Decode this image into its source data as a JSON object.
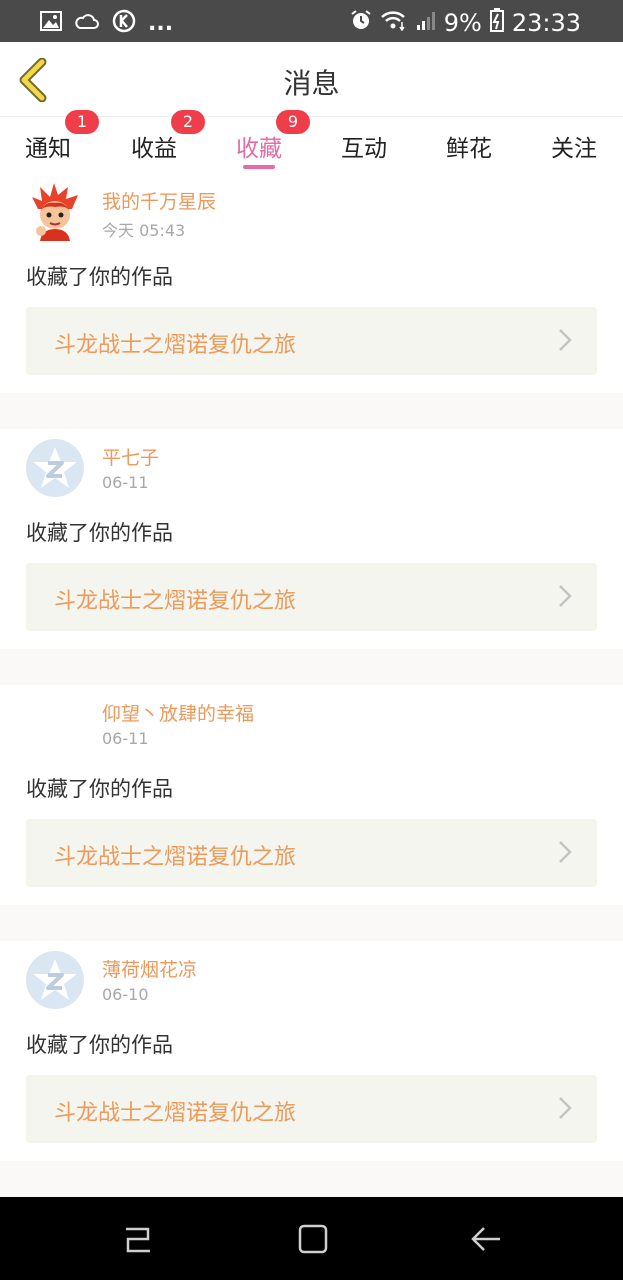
{
  "status_bar": {
    "icons_left": [
      "image-icon",
      "weather-icon",
      "k-icon"
    ],
    "ellipsis": "...",
    "icons_right": [
      "alarm-icon",
      "wifi-icon",
      "signal-icon",
      "battery-charging-icon"
    ],
    "battery": "9%",
    "time": "23:33"
  },
  "header": {
    "title": "消息",
    "back_icon": "chevron-left-icon"
  },
  "tabs": [
    {
      "label": "通知",
      "badge": "1",
      "active": false
    },
    {
      "label": "收益",
      "badge": "2",
      "active": false
    },
    {
      "label": "收藏",
      "badge": "9",
      "active": true
    },
    {
      "label": "互动",
      "badge": "",
      "active": false
    },
    {
      "label": "鲜花",
      "badge": "",
      "active": false
    },
    {
      "label": "关注",
      "badge": "",
      "active": false
    }
  ],
  "messages": [
    {
      "name": "我的千万星辰",
      "time": "今天 05:43",
      "action": "收藏了你的作品",
      "work": "斗龙战士之熠诺复仇之旅",
      "avatar": "cartoon-avatar"
    },
    {
      "name": "平七子",
      "time": "06-11",
      "action": "收藏了你的作品",
      "work": "斗龙战士之熠诺复仇之旅",
      "avatar": "default-star-avatar"
    },
    {
      "name": "仰望丶放肆的幸福",
      "time": "06-11",
      "action": "收藏了你的作品",
      "work": "斗龙战士之熠诺复仇之旅",
      "avatar": "blank-avatar"
    },
    {
      "name": "薄荷烟花凉",
      "time": "06-10",
      "action": "收藏了你的作品",
      "work": "斗龙战士之熠诺复仇之旅",
      "avatar": "default-star-avatar"
    }
  ],
  "colors": {
    "accent": "#e86aa6",
    "name": "#ec9a5c",
    "badge": "#f03d4a",
    "back": "#f3d64a"
  },
  "nav_bar": [
    "recent-apps-icon",
    "home-icon",
    "back-icon"
  ]
}
